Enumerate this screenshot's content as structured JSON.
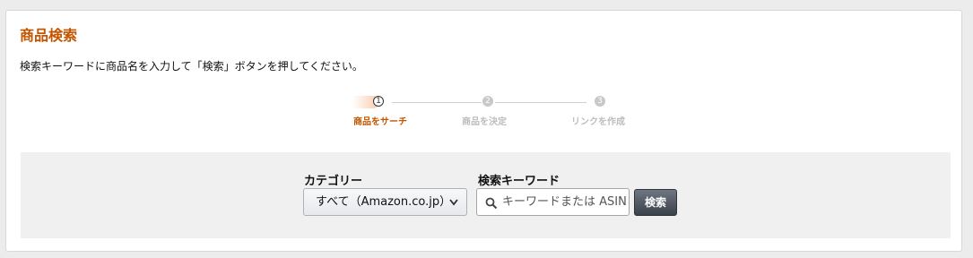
{
  "header": {
    "title": "商品検索",
    "description": "検索キーワードに商品名を入力して「検索」ボタンを押してください。"
  },
  "stepper": {
    "steps": [
      {
        "number": "1",
        "label": "商品をサーチ",
        "active": true
      },
      {
        "number": "2",
        "label": "商品を決定",
        "active": false
      },
      {
        "number": "3",
        "label": "リンクを作成",
        "active": false
      }
    ]
  },
  "search": {
    "category_label": "カテゴリー",
    "category_value": "すべて（Amazon.co.jp）",
    "keyword_label": "検索キーワード",
    "keyword_placeholder": "キーワードまたは ASIN",
    "keyword_value": "",
    "button_label": "検索"
  },
  "colors": {
    "accent": "#c45500",
    "button_bg": "#3a4149",
    "search_panel_bg": "#f0f0f0"
  },
  "icons": {
    "search": "search-icon",
    "dropdown": "chevron-down-icon"
  }
}
